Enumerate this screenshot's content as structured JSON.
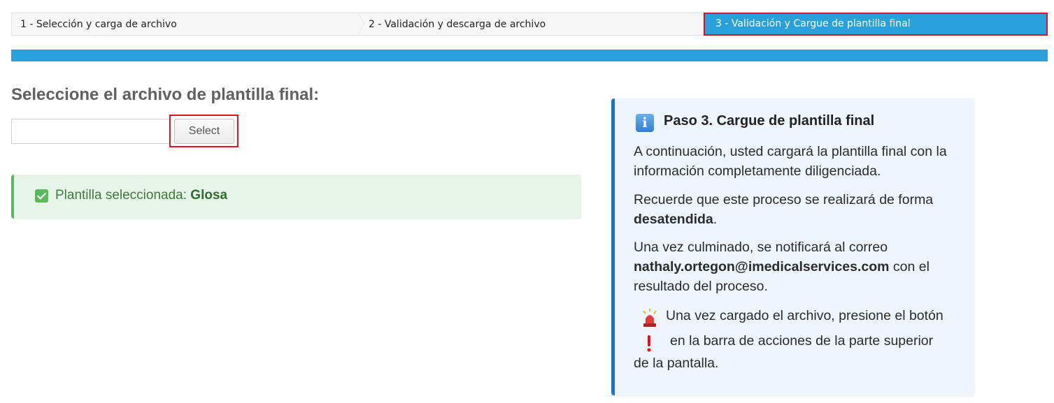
{
  "steps": [
    {
      "label": "1 - Selección y carga de archivo",
      "active": false
    },
    {
      "label": "2 - Validación y descarga de archivo",
      "active": false
    },
    {
      "label": "3 - Validación y Cargue de plantilla final",
      "active": true
    }
  ],
  "colors": {
    "accent": "#29a0da",
    "highlight_border": "#e0121c",
    "success": "#5cb85c",
    "info": "#1a73d0"
  },
  "main": {
    "title": "Seleccione el archivo de plantilla final:",
    "file_input_value": "",
    "select_label": "Select",
    "success": {
      "prefix": "Plantilla seleccionada: ",
      "value": "Glosa",
      "icon": "check-square-icon"
    }
  },
  "info": {
    "icon": "info-icon",
    "title": "Paso 3. Cargue de plantilla final",
    "p1": "A continuación, usted cargará la plantilla final con la información completamente diligenciada.",
    "p2_prefix": "Recuerde que este proceso se realizará de forma ",
    "p2_bold": "desatendida",
    "p2_suffix": ".",
    "p3_prefix": "Una vez culminado, se notificará al correo ",
    "p3_email": "nathaly.ortegon@imedicalservices.com",
    "p3_suffix": " con el resultado del proceso.",
    "alarm_line1": "Una vez cargado el archivo, presione el botón",
    "alarm_line2": "en la barra de acciones de la parte superior",
    "alarm_line3": "de la pantalla.",
    "siren_icon": "siren-icon",
    "exclamation_icon": "exclamation-icon"
  }
}
